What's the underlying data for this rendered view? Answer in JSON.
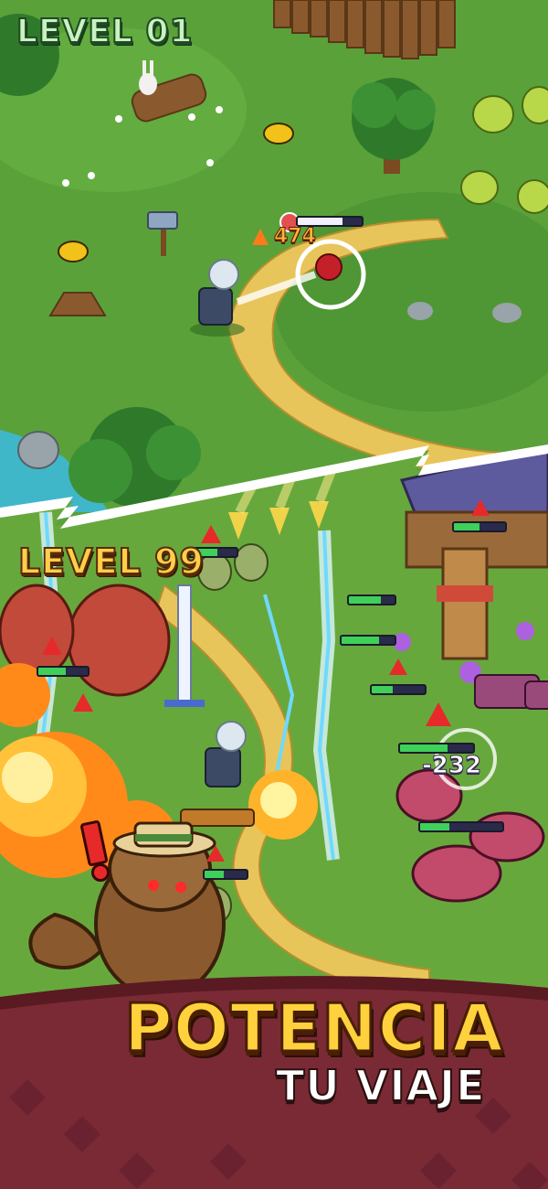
{
  "top_scene": {
    "level_label": "LEVEL 01",
    "damage_text": "474",
    "enemy_hp_fraction": 0.7
  },
  "bottom_scene": {
    "level_label": "LEVEL 99",
    "damage_text": "-232",
    "hp_bars": [
      0.6,
      0.5,
      0.7,
      0.4,
      0.8,
      0.55,
      0.65,
      0.35,
      0.7,
      0.45
    ]
  },
  "banner": {
    "headline": "POTENCIA",
    "subtitle": "TU VIAJE"
  },
  "colors": {
    "grass": "#5aa13a",
    "path": "#e8c55a",
    "banner_bg": "#7a2a35",
    "headline": "#ffd23d"
  },
  "icons": {
    "warning": "warning-triangle-icon",
    "fire": "fire-icon",
    "hammer": "hammer-icon",
    "sword": "sword-icon"
  }
}
